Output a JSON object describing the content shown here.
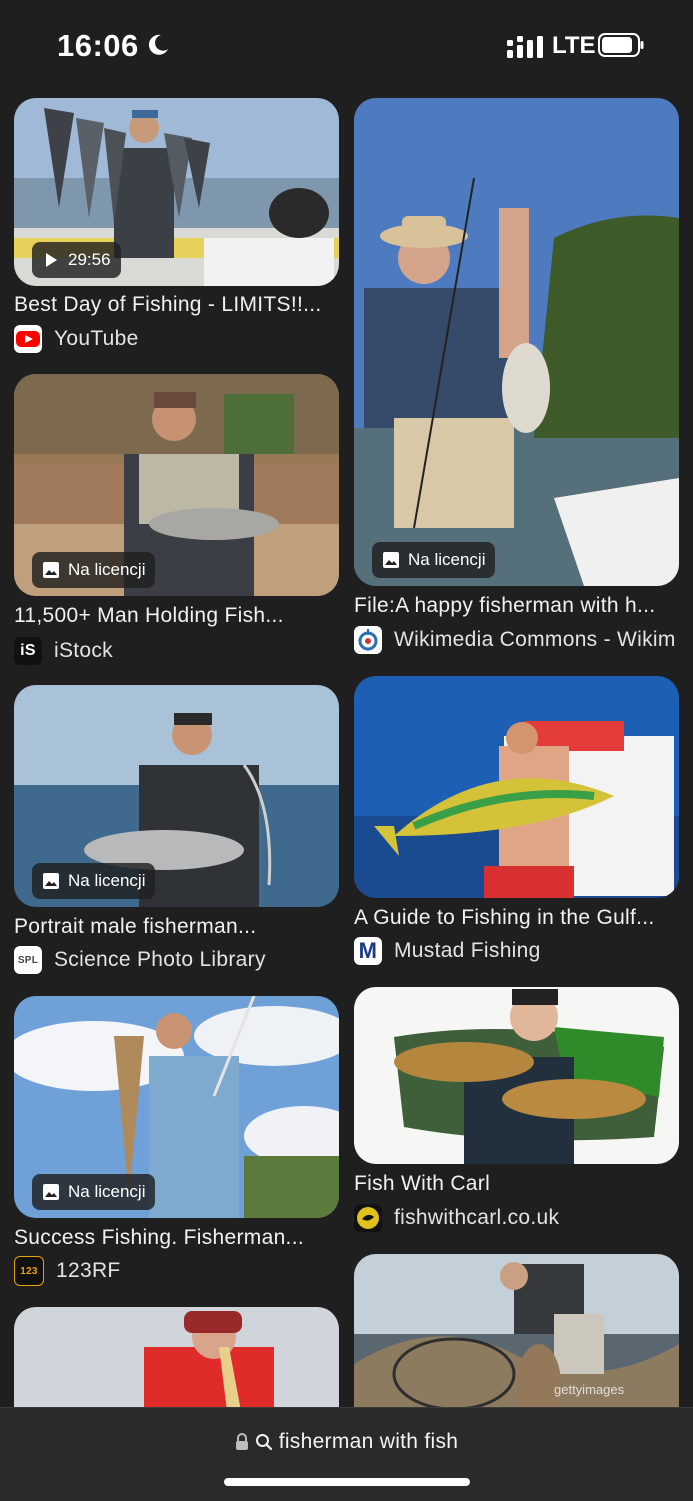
{
  "status": {
    "time": "16:06",
    "network": "LTE",
    "icons": [
      "moon-icon",
      "signal-icon",
      "battery-icon"
    ]
  },
  "results": {
    "left": [
      {
        "title": "Best Day of Fishing - LIMITS!!...",
        "source": "YouTube",
        "duration": "29:56",
        "favicon": "youtube-icon"
      },
      {
        "title": "11,500+ Man Holding Fish...",
        "source": "iStock",
        "badge": "Na licencji",
        "favicon": "istock-icon",
        "favicon_text": "iS"
      },
      {
        "title": "Portrait male fisherman...",
        "source": "Science Photo Library",
        "badge": "Na licencji",
        "favicon": "spl-icon",
        "favicon_text": "SPL"
      },
      {
        "title": "Success Fishing. Fisherman...",
        "source": "123RF",
        "badge": "Na licencji",
        "favicon": "123rf-icon",
        "favicon_text": "123"
      },
      {
        "title": "",
        "source": ""
      }
    ],
    "right": [
      {
        "title": "File:A happy fisherman with h...",
        "source": "Wikimedia Commons - Wikim",
        "badge": "Na licencji",
        "favicon": "wikimedia-icon"
      },
      {
        "title": "A Guide to Fishing in the Gulf...",
        "source": "Mustad Fishing",
        "favicon": "mustad-icon",
        "favicon_text": "M"
      },
      {
        "title": "Fish With Carl",
        "source": "fishwithcarl.co.uk",
        "favicon": "fishwithcarl-icon"
      },
      {
        "title": "",
        "source": "",
        "watermark": "gettyimages"
      }
    ]
  },
  "address_bar": {
    "query": "fisherman with fish",
    "icons": [
      "lock-icon",
      "search-icon"
    ]
  },
  "colors": {
    "background": "#1f1f1f",
    "bar": "#2a2a2a",
    "youtube": "#ff0000",
    "mustad": "#1a3a8c"
  }
}
